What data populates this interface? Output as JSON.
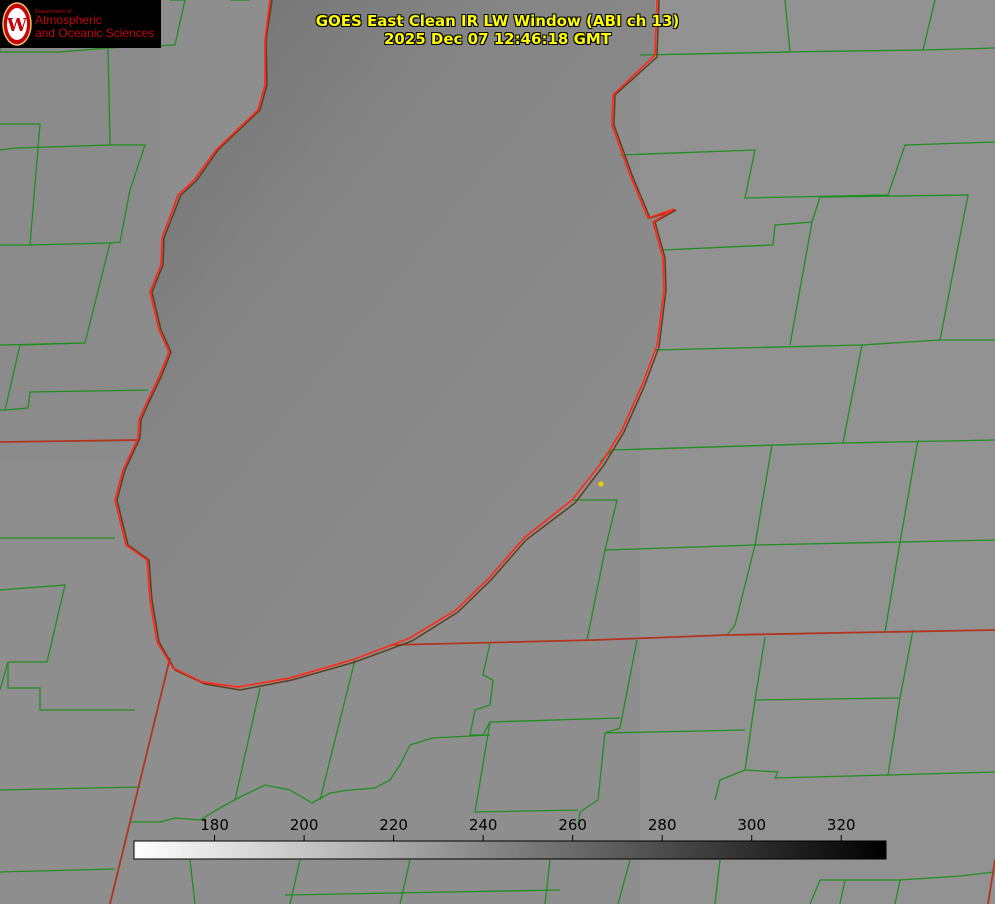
{
  "header": {
    "title_line1": "GOES East Clean IR LW Window (ABI ch 13)",
    "title_line2": "2025 Dec 07 12:46:18 GMT"
  },
  "logo": {
    "dept_text": "Department of",
    "line1": "Atmospheric",
    "line2": "and Oceanic Sciences",
    "emblem_letter": "W"
  },
  "colorbar": {
    "ticks": [
      "180",
      "200",
      "220",
      "240",
      "260",
      "280",
      "300",
      "320"
    ],
    "tick_values": [
      180,
      200,
      220,
      240,
      260,
      280,
      300,
      320
    ],
    "min_value": 162,
    "max_value": 330,
    "low_color": "#ffffff",
    "high_color": "#000000"
  },
  "map": {
    "background_color": "#8e8e8e",
    "lake_color": "#8a8a8a",
    "county_line_color": "#1f8f1f",
    "state_line_color": "#b0361f",
    "shoreline_color": "#ff2a1a",
    "marker_color": "#e8d000"
  }
}
